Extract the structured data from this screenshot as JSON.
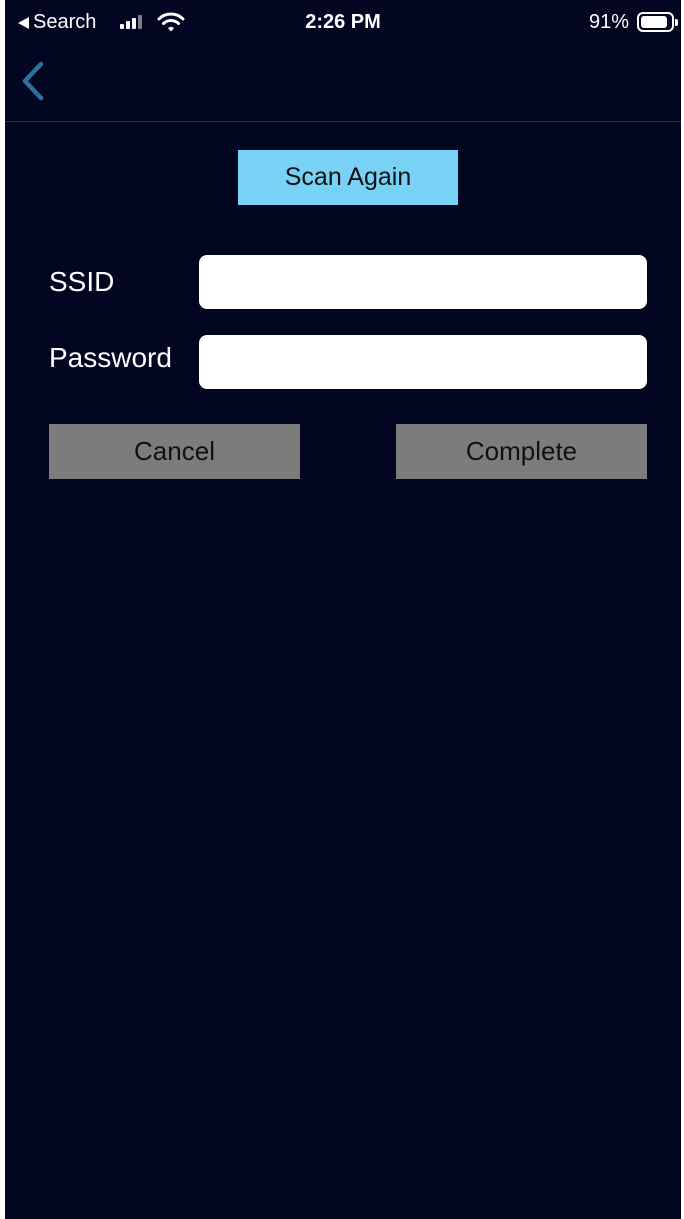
{
  "status_bar": {
    "back_app": "Search",
    "time": "2:26 PM",
    "battery_pct": "91%",
    "battery_level": 0.91,
    "icons": [
      "back-triangle-icon",
      "signal-icon",
      "wifi-icon",
      "battery-icon"
    ]
  },
  "nav": {
    "back_icon": "chevron-left-icon",
    "accent": "#2f6fa3"
  },
  "form": {
    "scan_again_label": "Scan Again",
    "ssid_label": "SSID",
    "ssid_value": "",
    "password_label": "Password",
    "password_value": ""
  },
  "actions": {
    "cancel_label": "Cancel",
    "complete_label": "Complete"
  },
  "colors": {
    "background": "#020621",
    "scan_button": "#78d2f6",
    "action_button": "#7c7c7c",
    "field": "#ffffff"
  }
}
